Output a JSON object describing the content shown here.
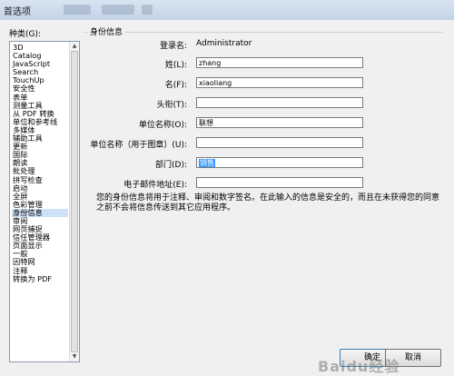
{
  "window": {
    "title": "首选项"
  },
  "categories": {
    "label": "种类(G):",
    "items": [
      "3D",
      "Catalog",
      "JavaScript",
      "Search",
      "TouchUp",
      "安全性",
      "表单",
      "测量工具",
      "从 PDF 转换",
      "单位和参考线",
      "多媒体",
      "辅助工具",
      "更新",
      "国际",
      "朗读",
      "批处理",
      "拼写检查",
      "启动",
      "全屏",
      "色彩管理",
      "身份信息",
      "审阅",
      "网页捕捉",
      "信任管理器",
      "页面显示",
      "一般",
      "因特网",
      "注释",
      "转换为 PDF"
    ],
    "selected_index": 20
  },
  "identity": {
    "group_title": "身份信息",
    "login_label": "登录名:",
    "login_value": "Administrator",
    "last_name_label": "姓(L):",
    "last_name_value": "zhang",
    "first_name_label": "名(F):",
    "first_name_value": "xiaoliang",
    "title_label": "头衔(T):",
    "title_value": "",
    "org_label": "单位名称(O):",
    "org_value": "联想",
    "org_unit_label": "单位名称（用于图章）(U):",
    "org_unit_value": "",
    "dept_label": "部门(D):",
    "dept_value": "销售",
    "email_label": "电子邮件地址(E):",
    "email_value": "",
    "note": "您的身份信息将用于注释、审阅和数字签名。在此输入的信息是安全的，而且在未获得您的同意之前不会将信息传送到其它应用程序。"
  },
  "buttons": {
    "ok": "确定",
    "cancel": "取消"
  },
  "watermark": "Baidu经验"
}
